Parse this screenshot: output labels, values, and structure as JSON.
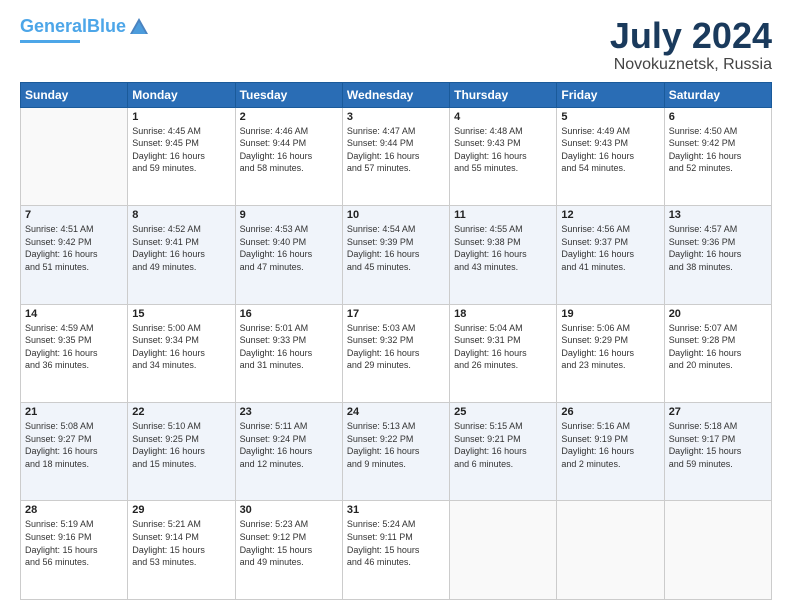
{
  "header": {
    "logo_line1": "General",
    "logo_line2": "Blue",
    "title": "July 2024",
    "subtitle": "Novokuznetsk, Russia"
  },
  "weekdays": [
    "Sunday",
    "Monday",
    "Tuesday",
    "Wednesday",
    "Thursday",
    "Friday",
    "Saturday"
  ],
  "weeks": [
    [
      {
        "num": "",
        "info": ""
      },
      {
        "num": "1",
        "info": "Sunrise: 4:45 AM\nSunset: 9:45 PM\nDaylight: 16 hours\nand 59 minutes."
      },
      {
        "num": "2",
        "info": "Sunrise: 4:46 AM\nSunset: 9:44 PM\nDaylight: 16 hours\nand 58 minutes."
      },
      {
        "num": "3",
        "info": "Sunrise: 4:47 AM\nSunset: 9:44 PM\nDaylight: 16 hours\nand 57 minutes."
      },
      {
        "num": "4",
        "info": "Sunrise: 4:48 AM\nSunset: 9:43 PM\nDaylight: 16 hours\nand 55 minutes."
      },
      {
        "num": "5",
        "info": "Sunrise: 4:49 AM\nSunset: 9:43 PM\nDaylight: 16 hours\nand 54 minutes."
      },
      {
        "num": "6",
        "info": "Sunrise: 4:50 AM\nSunset: 9:42 PM\nDaylight: 16 hours\nand 52 minutes."
      }
    ],
    [
      {
        "num": "7",
        "info": "Sunrise: 4:51 AM\nSunset: 9:42 PM\nDaylight: 16 hours\nand 51 minutes."
      },
      {
        "num": "8",
        "info": "Sunrise: 4:52 AM\nSunset: 9:41 PM\nDaylight: 16 hours\nand 49 minutes."
      },
      {
        "num": "9",
        "info": "Sunrise: 4:53 AM\nSunset: 9:40 PM\nDaylight: 16 hours\nand 47 minutes."
      },
      {
        "num": "10",
        "info": "Sunrise: 4:54 AM\nSunset: 9:39 PM\nDaylight: 16 hours\nand 45 minutes."
      },
      {
        "num": "11",
        "info": "Sunrise: 4:55 AM\nSunset: 9:38 PM\nDaylight: 16 hours\nand 43 minutes."
      },
      {
        "num": "12",
        "info": "Sunrise: 4:56 AM\nSunset: 9:37 PM\nDaylight: 16 hours\nand 41 minutes."
      },
      {
        "num": "13",
        "info": "Sunrise: 4:57 AM\nSunset: 9:36 PM\nDaylight: 16 hours\nand 38 minutes."
      }
    ],
    [
      {
        "num": "14",
        "info": "Sunrise: 4:59 AM\nSunset: 9:35 PM\nDaylight: 16 hours\nand 36 minutes."
      },
      {
        "num": "15",
        "info": "Sunrise: 5:00 AM\nSunset: 9:34 PM\nDaylight: 16 hours\nand 34 minutes."
      },
      {
        "num": "16",
        "info": "Sunrise: 5:01 AM\nSunset: 9:33 PM\nDaylight: 16 hours\nand 31 minutes."
      },
      {
        "num": "17",
        "info": "Sunrise: 5:03 AM\nSunset: 9:32 PM\nDaylight: 16 hours\nand 29 minutes."
      },
      {
        "num": "18",
        "info": "Sunrise: 5:04 AM\nSunset: 9:31 PM\nDaylight: 16 hours\nand 26 minutes."
      },
      {
        "num": "19",
        "info": "Sunrise: 5:06 AM\nSunset: 9:29 PM\nDaylight: 16 hours\nand 23 minutes."
      },
      {
        "num": "20",
        "info": "Sunrise: 5:07 AM\nSunset: 9:28 PM\nDaylight: 16 hours\nand 20 minutes."
      }
    ],
    [
      {
        "num": "21",
        "info": "Sunrise: 5:08 AM\nSunset: 9:27 PM\nDaylight: 16 hours\nand 18 minutes."
      },
      {
        "num": "22",
        "info": "Sunrise: 5:10 AM\nSunset: 9:25 PM\nDaylight: 16 hours\nand 15 minutes."
      },
      {
        "num": "23",
        "info": "Sunrise: 5:11 AM\nSunset: 9:24 PM\nDaylight: 16 hours\nand 12 minutes."
      },
      {
        "num": "24",
        "info": "Sunrise: 5:13 AM\nSunset: 9:22 PM\nDaylight: 16 hours\nand 9 minutes."
      },
      {
        "num": "25",
        "info": "Sunrise: 5:15 AM\nSunset: 9:21 PM\nDaylight: 16 hours\nand 6 minutes."
      },
      {
        "num": "26",
        "info": "Sunrise: 5:16 AM\nSunset: 9:19 PM\nDaylight: 16 hours\nand 2 minutes."
      },
      {
        "num": "27",
        "info": "Sunrise: 5:18 AM\nSunset: 9:17 PM\nDaylight: 15 hours\nand 59 minutes."
      }
    ],
    [
      {
        "num": "28",
        "info": "Sunrise: 5:19 AM\nSunset: 9:16 PM\nDaylight: 15 hours\nand 56 minutes."
      },
      {
        "num": "29",
        "info": "Sunrise: 5:21 AM\nSunset: 9:14 PM\nDaylight: 15 hours\nand 53 minutes."
      },
      {
        "num": "30",
        "info": "Sunrise: 5:23 AM\nSunset: 9:12 PM\nDaylight: 15 hours\nand 49 minutes."
      },
      {
        "num": "31",
        "info": "Sunrise: 5:24 AM\nSunset: 9:11 PM\nDaylight: 15 hours\nand 46 minutes."
      },
      {
        "num": "",
        "info": ""
      },
      {
        "num": "",
        "info": ""
      },
      {
        "num": "",
        "info": ""
      }
    ]
  ]
}
